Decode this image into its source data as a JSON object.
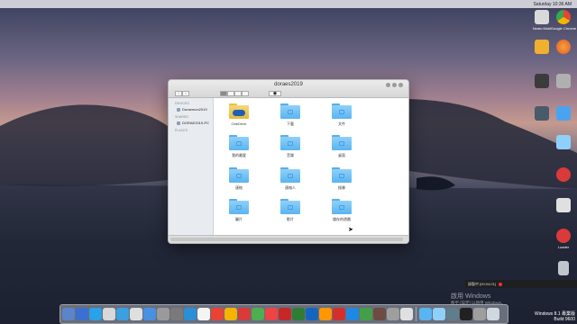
{
  "menubar": {
    "clock": "Saturday 10:36 AM"
  },
  "desktop_icons": [
    {
      "label": "Neato Mobi",
      "color": "#d9d9d9",
      "icon": "app-icon"
    },
    {
      "label": "Google Chrome",
      "color": "#e84335",
      "icon": "chrome-icon"
    },
    {
      "label": "",
      "color": "#e25a2b",
      "icon": "firefox-icon"
    },
    {
      "label": "",
      "color": "#4aa3f0",
      "icon": "app-icon"
    },
    {
      "label": "",
      "color": "#f0b030",
      "icon": "app-icon"
    },
    {
      "label": "",
      "color": "#555555",
      "icon": "app-icon"
    },
    {
      "label": "Recycle Bin",
      "color": "#c0c6cc",
      "icon": "recycle-bin-icon"
    },
    {
      "label": "Loader",
      "color": "#d93a3a",
      "icon": "app-icon"
    },
    {
      "label": "",
      "color": "#4a4a4a",
      "icon": "app-icon"
    }
  ],
  "window": {
    "title": "doraes2019",
    "sidebar": {
      "sections": [
        {
          "header": "DEVICES",
          "items": [
            "Doraemon2019"
          ]
        },
        {
          "header": "SHARED",
          "items": [
            "DORAE2019-PC"
          ]
        },
        {
          "header": "PLACES",
          "items": []
        }
      ]
    },
    "items": [
      {
        "label": "OneDrive",
        "type": "onedrive"
      },
      {
        "label": "下載",
        "type": "folder"
      },
      {
        "label": "文件",
        "type": "folder"
      },
      {
        "label": "我的最愛",
        "type": "folder"
      },
      {
        "label": "音樂",
        "type": "folder"
      },
      {
        "label": "桌面",
        "type": "folder"
      },
      {
        "label": "連結",
        "type": "folder"
      },
      {
        "label": "連絡人",
        "type": "folder"
      },
      {
        "label": "搜尋",
        "type": "folder"
      },
      {
        "label": "圖片",
        "type": "folder"
      },
      {
        "label": "影片",
        "type": "folder"
      },
      {
        "label": "儲存的遊戲",
        "type": "folder"
      }
    ]
  },
  "recorder": {
    "text": "錄製中 [00:04:01]"
  },
  "watermark": {
    "title": "啟用 Windows",
    "subtitle": "移至 [設定] 以啟用 Windows。"
  },
  "build": {
    "line1": "Windows 8.1 專業版",
    "line2": "Build 9600"
  },
  "dock_colors": [
    "#5c84c8",
    "#3b6fd1",
    "#2aa1e8",
    "#d8d8d8",
    "#3aa0e0",
    "#dfdfdf",
    "#4a90e2",
    "#9a9a9a",
    "#7a7a7a",
    "#2a8fd6",
    "#f4f4f4",
    "#e84335",
    "#f4b400",
    "#d93a3a",
    "#4caf50",
    "#e44",
    "#c62828",
    "#2e7d32",
    "#1565c0",
    "#ff9800",
    "#d32f2f",
    "#1e88e5",
    "#43a047",
    "#6d4c41",
    "#9e9e9e",
    "#e0e0e0",
    "#5ab4f0",
    "#8fd0fb",
    "#607d8b",
    "#212121",
    "#9e9e9e",
    "#cfd8dc"
  ]
}
